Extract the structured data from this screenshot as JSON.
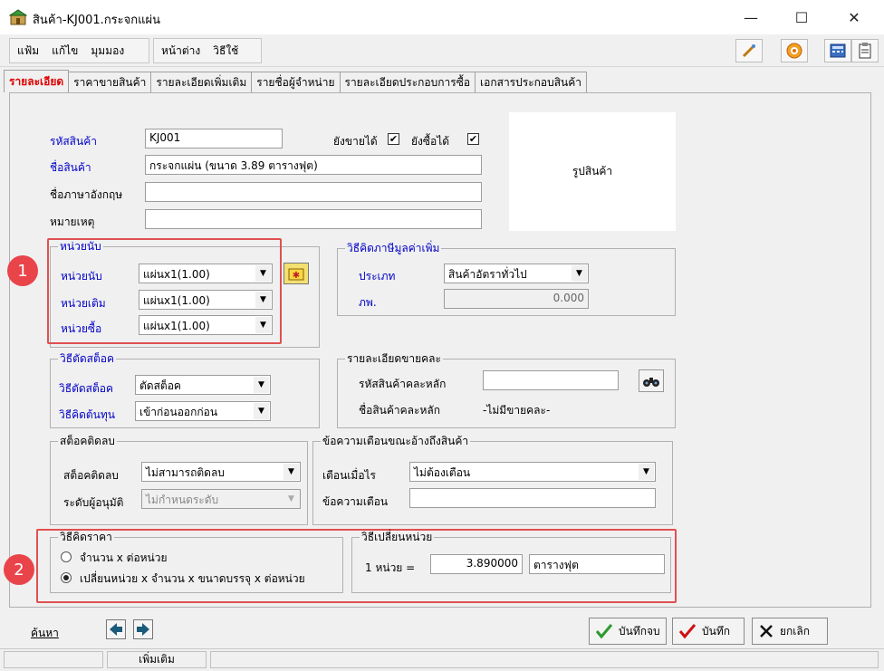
{
  "window": {
    "title": "สินค้า-KJ001.กระจกแผ่น",
    "controls": {
      "minimize": "—",
      "maximize": "☐",
      "close": "✕"
    }
  },
  "menu": {
    "items": [
      "แฟ้ม",
      "แก้ไข",
      "มุมมอง"
    ],
    "items2": [
      "หน้าต่าง",
      "วิธีใช้"
    ]
  },
  "toolbar": {
    "icons": [
      "pen-icon",
      "target-icon",
      "calculator-icon",
      "clipboard-icon"
    ]
  },
  "tabs": [
    {
      "label": "รายละเอียด",
      "active": true
    },
    {
      "label": "ราคาขายสินค้า",
      "active": false
    },
    {
      "label": "รายละเอียดเพิ่มเติม",
      "active": false
    },
    {
      "label": "รายชื่อผู้จำหน่าย",
      "active": false
    },
    {
      "label": "รายละเอียดประกอบการซื้อ",
      "active": false
    },
    {
      "label": "เอกสารประกอบสินค้า",
      "active": false
    }
  ],
  "product": {
    "code_label": "รหัสสินค้า",
    "code_value": "KJ001",
    "can_sell_label": "ยังขายได้",
    "can_sell": true,
    "can_buy_label": "ยังซื้อได้",
    "can_buy": true,
    "name_label": "ชื่อสินค้า",
    "name_value": "กระจกแผ่น (ขนาด 3.89 ตารางฟุต)",
    "name_en_label": "ชื่อภาษาอังกฤษ",
    "name_en_value": "",
    "note_label": "หมายเหตุ",
    "note_value": "",
    "image_label": "รูปสินค้า"
  },
  "units": {
    "group_title": "หน่วยนับ",
    "unit_label": "หน่วยนับ",
    "unit_value": "แผ่นx1(1.00)",
    "stock_unit_label": "หน่วยเติม",
    "stock_unit_value": "แผ่นx1(1.00)",
    "buy_unit_label": "หน่วยซื้อ",
    "buy_unit_value": "แผ่นx1(1.00)"
  },
  "vat": {
    "group_title": "วิธีคิดภาษีมูลค่าเพิ่ม",
    "type_label": "ประเภท",
    "type_value": "สินค้าอัตราทั่วไป",
    "rate_label": "ภพ.",
    "rate_value": "0.000"
  },
  "stock_cut": {
    "group_title": "วิธีตัดสต็อค",
    "method_label": "วิธีตัดสต็อค",
    "method_value": "ตัดสต็อค",
    "cost_label": "วิธีคิดต้นทุน",
    "cost_value": "เข้าก่อนออกก่อน"
  },
  "sale_detail": {
    "group_title": "รายละเอียดขายคละ",
    "main_code_label": "รหัสสินค้าคละหลัก",
    "main_code_value": "",
    "main_name_label": "ชื่อสินค้าคละหลัก",
    "main_name_value": "-ไม่มีขายคละ-"
  },
  "negative_stock": {
    "group_title": "สต็อคติดลบ",
    "stock_label": "สต็อคติดลบ",
    "stock_value": "ไม่สามารถติดลบ",
    "approver_label": "ระดับผู้อนุมัติ",
    "approver_value": "ไม่กำหนดระดับ"
  },
  "warning": {
    "group_title": "ข้อความเตือนขณะอ้างถึงสินค้า",
    "when_label": "เตือนเมื่อไร",
    "when_value": "ไม่ต้องเตือน",
    "message_label": "ข้อความเตือน",
    "message_value": ""
  },
  "pricing": {
    "group_title": "วิธีคิดราคา",
    "option1": "จำนวน x ต่อหน่วย",
    "option2": "เปลี่ยนหน่วย x จำนวน x ขนาดบรรจุ x ต่อหน่วย",
    "selected": 2
  },
  "unit_convert": {
    "group_title": "วิธีเปลี่ยนหน่วย",
    "label": "1 หน่วย =",
    "value": "3.890000",
    "unit": "ตารางฟุต"
  },
  "badges": {
    "one": "1",
    "two": "2"
  },
  "footer": {
    "search_link": "ค้นหา",
    "save_close": "บันทึกจบ",
    "save": "บันทึก",
    "cancel": "ยกเลิก"
  },
  "status": {
    "cell2": "เพิ่มเติม"
  },
  "colors": {
    "accent_red": "#e05050",
    "label_blue": "#0000c8",
    "tab_active": "#e00000"
  }
}
